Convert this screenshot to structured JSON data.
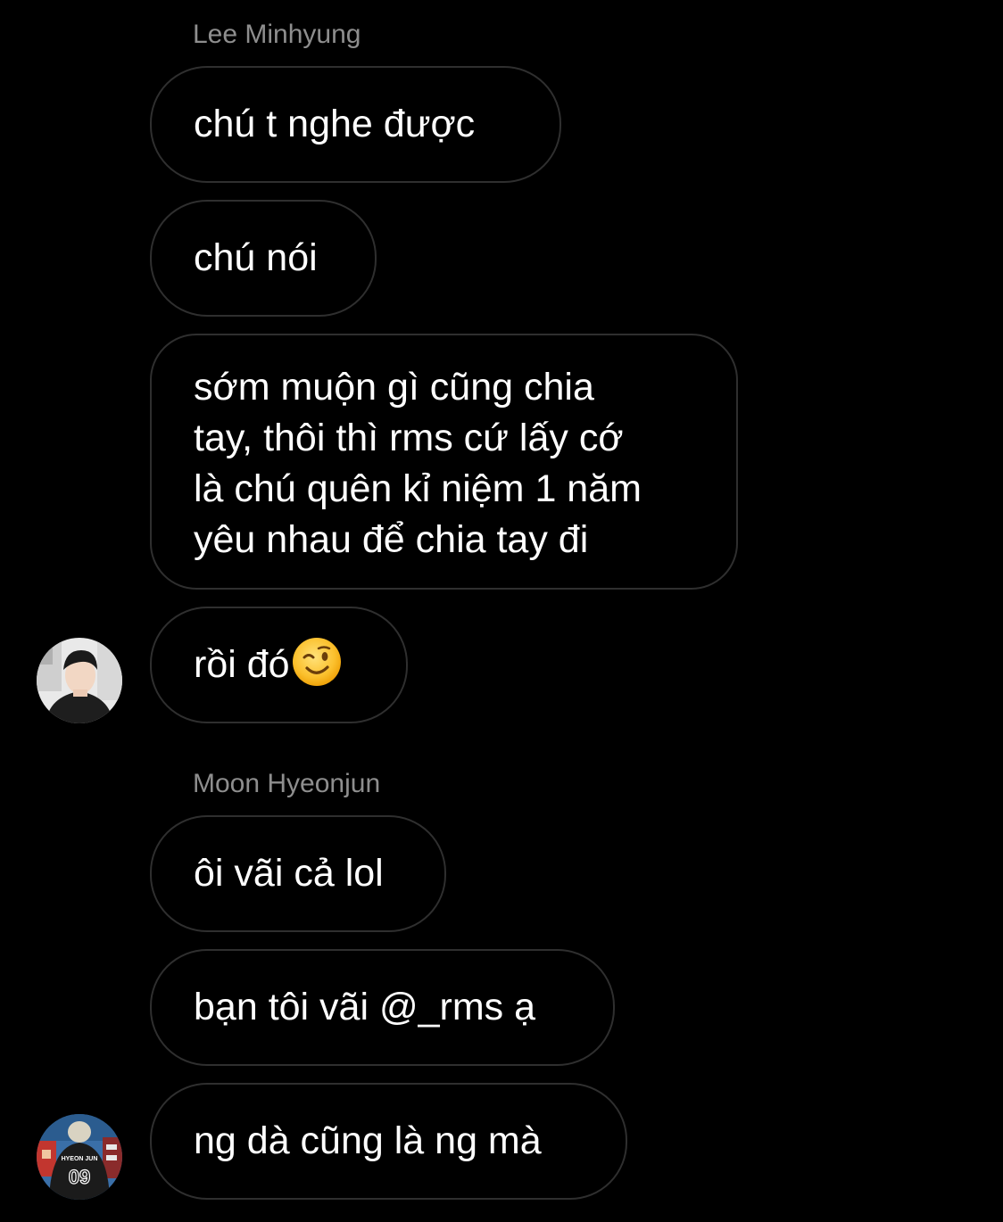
{
  "conversation": {
    "groups": [
      {
        "sender": "Lee Minhyung",
        "messages": [
          "chú t nghe được",
          "chú nói",
          "sớm muộn gì cũng chia\ntay, thôi thì rms cứ lấy cớ\nlà chú quên kỉ niệm 1 năm\nyêu nhau để chia tay đi",
          "rồi đó"
        ],
        "last_message_emoji": "winking-face-emoji",
        "avatar": "avatar-lee-minhyung"
      },
      {
        "sender": "Moon Hyeonjun",
        "messages": [
          "ôi vãi cả lol",
          "bạn tôi vãi @_rms ạ",
          "ng dà cũng là ng mà"
        ],
        "avatar": "avatar-moon-hyeonjun",
        "avatar_jersey_text": "HYEON JUN",
        "avatar_jersey_number": "09"
      }
    ]
  },
  "theme": {
    "background": "#000000",
    "bubble_border": "#2f2f2f",
    "sender_name_color": "#8e8e8e",
    "message_text_color": "#ffffff"
  }
}
